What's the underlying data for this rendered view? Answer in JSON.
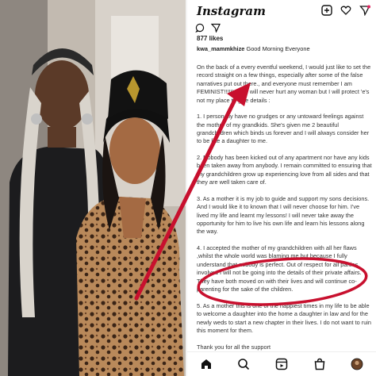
{
  "app": {
    "name": "Instagram"
  },
  "icons": {
    "top": [
      "new-post-icon",
      "heart-icon",
      "messenger-icon"
    ],
    "actions": [
      "comment-icon",
      "share-icon"
    ],
    "nav": [
      "home-icon",
      "search-icon",
      "reels-icon",
      "shop-icon",
      "profile-icon"
    ]
  },
  "post": {
    "likes": "877 likes",
    "username": "kwa_mammkhize",
    "caption": "Good Morning Everyone",
    "paragraphs": [
      "On the back of a every eventful weekend, I would just like to set the record straight on a few things, especially after some of the false narratives put out there., and everyone must remember I am FEMINIST!!!!!! and I will never hurt any woman but I will protect 'e's not my place to give details :",
      "1. I personally have no grudges  or any untoward feelings against the mother of my grandkids. She's given me 2 beautiful grandchildren which binds us forever and I will always consider her to be like a daughter to me.",
      "2. Nobody has been kicked out of any apartment nor have any kids been taken away from anybody. I remain committed to ensuring that my grandchildren grow up experiencing love from all sides and that they are well taken care of.",
      "3. As a mother it is my job to guide and support my sons decisions. And I would like it to known that I will never choose for him. I've lived my life and learnt my lessons! I will never take away the opportunity for him to live his own life and learn his lessons along the way.",
      "4. I accepted the mother of my grandchildren with all her flaws ,whilst the whole world was blaming me but  because I fully understand that nobody is perfect. Out of respect for all parties involved I will not be going into the details of their private affairs. They have both moved on with their lives and will continue co-parenting for the sake of the children.",
      "5. As a mother this is one of the happiest times in my life to be able to welcome a daughter into the home a daughter in law and for the newly weds to start a new chapter in their lives. I do not want to ruin this moment for them.",
      "Thank you for all the support"
    ]
  },
  "colors": {
    "annotation": "#c8102e",
    "text": "#333333"
  }
}
